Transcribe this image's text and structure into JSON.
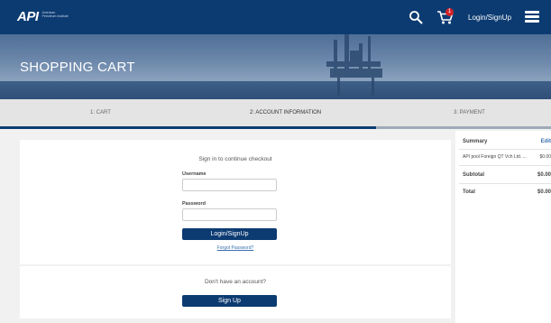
{
  "header": {
    "logo_text": "API",
    "logo_subtext": "American Petroleum Institute",
    "cart_count": "1",
    "login_label": "Login/SignUp",
    "icons": [
      "search-icon",
      "cart-icon",
      "menu-icon"
    ]
  },
  "hero": {
    "title": "SHOPPING CART"
  },
  "steps": [
    {
      "label": "1: CART",
      "state": "done"
    },
    {
      "label": "2: ACCOUNT INFORMATION",
      "state": "active"
    },
    {
      "label": "3: PAYMENT",
      "state": "pending"
    }
  ],
  "login": {
    "title": "Sign in to continue checkout",
    "username_label": "Username",
    "username_value": "",
    "password_label": "Password",
    "password_value": "",
    "submit_label": "Login/SignUp",
    "forgot_label": "Forgot Password?"
  },
  "signup": {
    "title": "Don't have an account?",
    "button_label": "Sign Up"
  },
  "summary": {
    "title": "Summary",
    "edit_label": "Edit",
    "item_label": "API pool Foreign QT Vch Ltd. ...",
    "item_price": "$0.00",
    "subtotal_label": "Subtotal",
    "subtotal_value": "$0.00",
    "total_label": "Total",
    "total_value": "$0.00"
  },
  "colors": {
    "brand": "#0c3b72",
    "badge": "#d3222a",
    "link": "#3b6fb0"
  }
}
